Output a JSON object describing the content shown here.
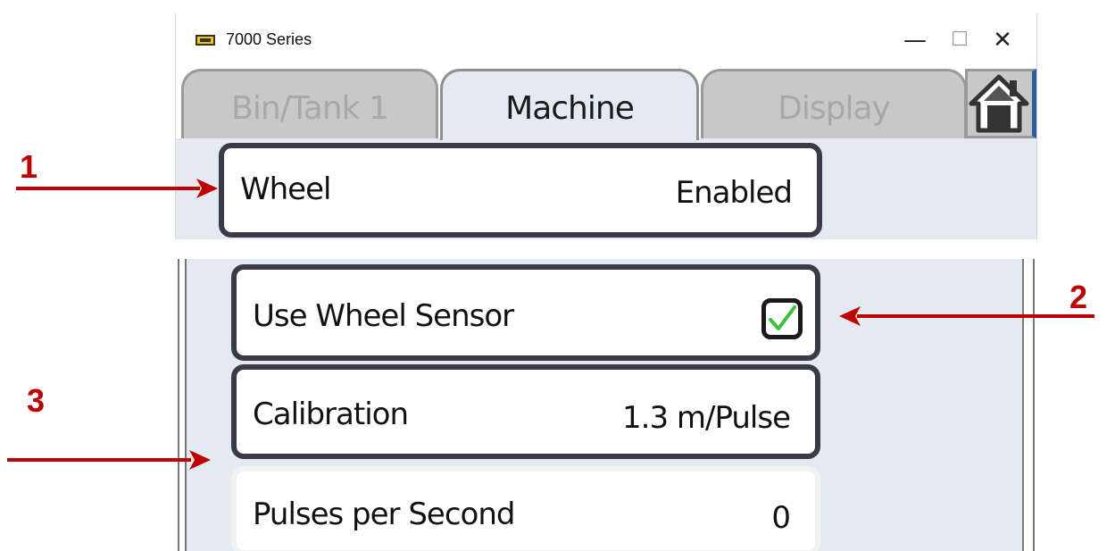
{
  "window": {
    "title": "7000 Series",
    "controls": {
      "minimize": "—",
      "maximize": "☐",
      "close": "✕"
    }
  },
  "tabs": [
    {
      "label": "Bin/Tank 1",
      "active": false
    },
    {
      "label": "Machine",
      "active": true
    },
    {
      "label": "Display",
      "active": false
    }
  ],
  "home_icon": "house-icon",
  "wheel_row": {
    "label": "Wheel",
    "value": "Enabled"
  },
  "settings": {
    "use_wheel_sensor": {
      "label": "Use Wheel Sensor",
      "checked": true
    },
    "calibration": {
      "label": "Calibration",
      "value": "1.3 m/Pulse"
    },
    "pulses_per_second": {
      "label": "Pulses per Second",
      "value": "0"
    }
  },
  "callouts": {
    "one": "1",
    "two": "2",
    "three": "3"
  },
  "colors": {
    "accent_red": "#c00000",
    "check_green": "#3cc23c",
    "panel_border": "#3a3a48",
    "content_bg": "#e4eaf1"
  }
}
